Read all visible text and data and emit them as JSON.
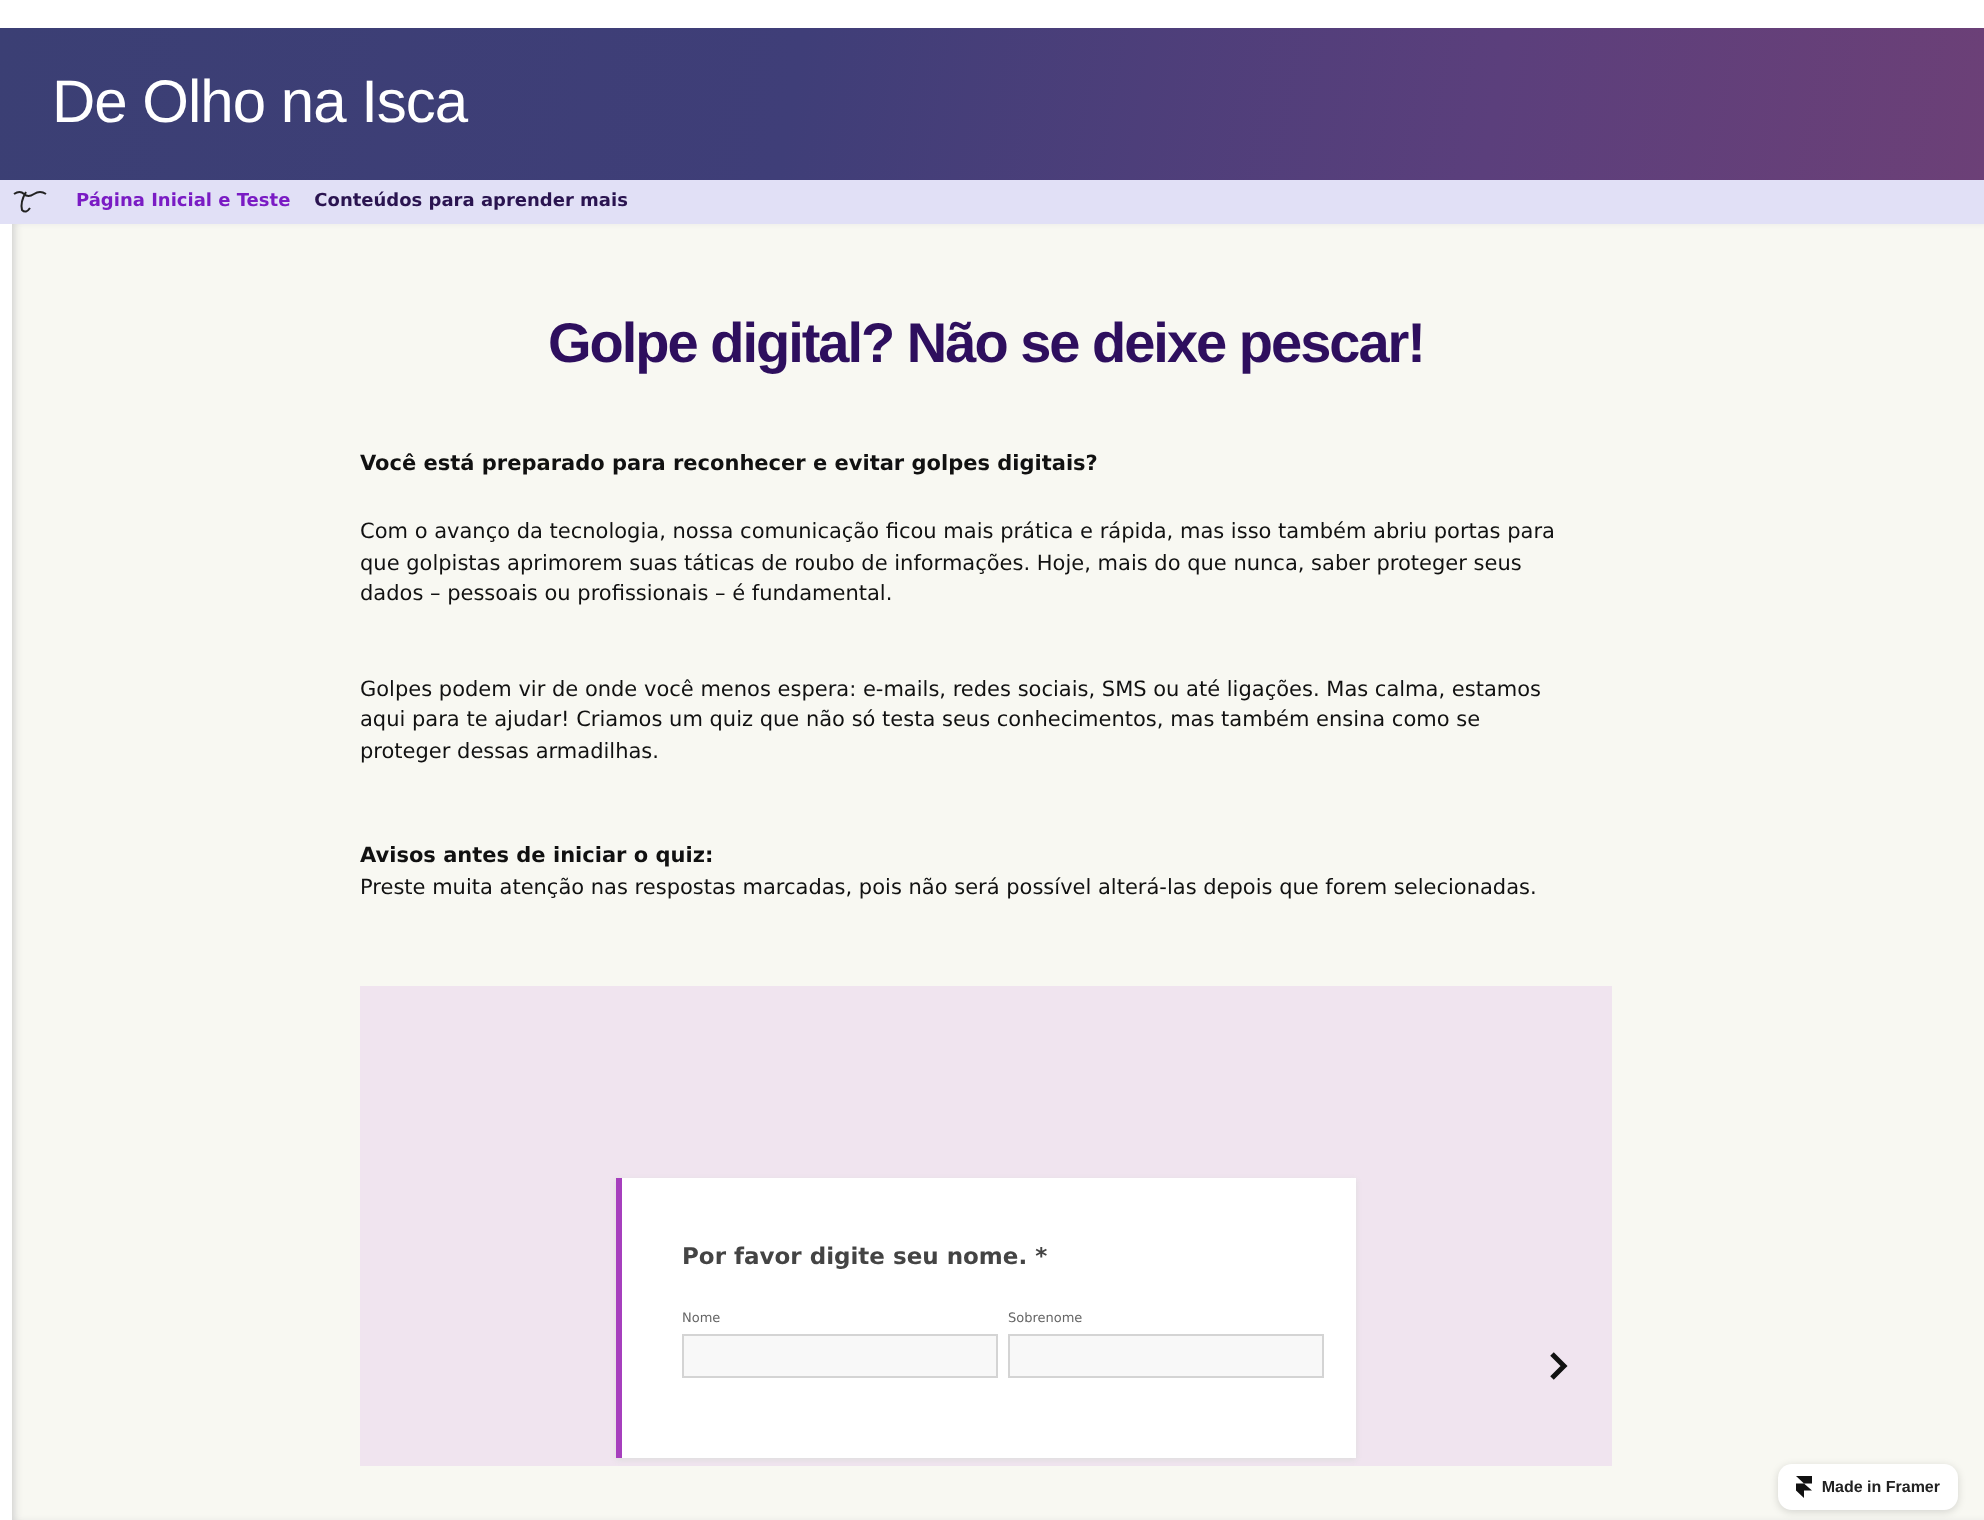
{
  "site": {
    "title": "De Olho na Isca"
  },
  "nav": [
    {
      "label": "Página Inicial e Teste",
      "selected": true
    },
    {
      "label": "Conteúdos para aprender mais",
      "selected": false
    }
  ],
  "main": {
    "heading": "Golpe digital? Não se deixe pescar!",
    "question": "Você está preparado para reconhecer e evitar golpes digitais?",
    "paragraphs": [
      "Com o avanço da tecnologia, nossa comunicação ficou mais prática e rápida, mas isso também abriu portas para que golpistas aprimorem suas táticas de roubo de informações. Hoje, mais do que nunca, saber proteger seus dados – pessoais ou profissionais – é fundamental.",
      "Golpes podem vir de onde você menos espera: e-mails, redes sociais, SMS ou até ligações. Mas calma, estamos aqui para te ajudar! Criamos um quiz que não só testa seus conhecimentos, mas também ensina como se proteger dessas armadilhas."
    ],
    "notice_title": "Avisos antes de iniciar o quiz:",
    "notice_text": "Preste muita atenção nas respostas marcadas, pois não será possível alterá-las depois que forem selecionadas."
  },
  "quiz": {
    "question": "Por favor digite seu nome. *",
    "fields": [
      {
        "label": "Nome"
      },
      {
        "label": "Sobrenome"
      }
    ]
  },
  "badge": {
    "label": "Made in Framer"
  }
}
